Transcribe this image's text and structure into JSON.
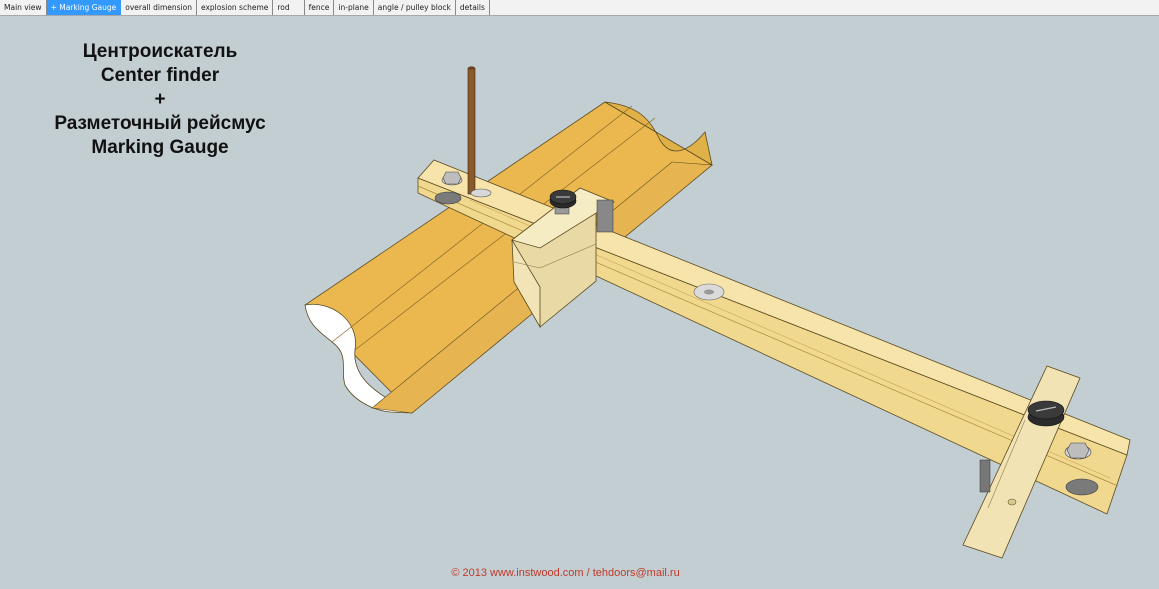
{
  "tabs": [
    {
      "label": "Main view",
      "active": false
    },
    {
      "label": "+ Marking Gauge",
      "active": true
    },
    {
      "label": "overall dimension",
      "active": false
    },
    {
      "label": "explosion scheme",
      "active": false
    },
    {
      "label": "rod",
      "active": false
    },
    {
      "label": "fence",
      "active": false
    },
    {
      "label": "in-plane",
      "active": false
    },
    {
      "label": "angle / pulley block",
      "active": false
    },
    {
      "label": "details",
      "active": false
    }
  ],
  "title": {
    "line1": "Центроискатель",
    "line2": "Center finder",
    "line3": "+",
    "line4": "Разметочный рейсмус",
    "line5": "Marking Gauge"
  },
  "footer": {
    "copyright": "© 2013 www.instwood.com / tehdoors@mail.ru"
  },
  "colors": {
    "background": "#c3ced2",
    "active_tab": "#3399ff",
    "footer_text": "#c0392b"
  }
}
